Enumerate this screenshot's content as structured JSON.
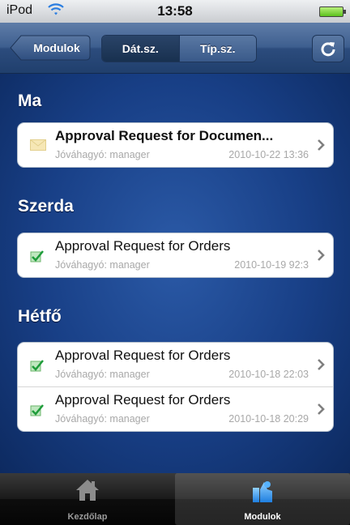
{
  "status": {
    "device": "iPod",
    "time": "13:58"
  },
  "nav": {
    "back_label": "Modulok",
    "segments": [
      {
        "label": "Dát.sz."
      },
      {
        "label": "Típ.sz."
      }
    ],
    "selected_segment": 0,
    "refresh_icon": "refresh-icon"
  },
  "sections": [
    {
      "title": "Ma",
      "items": [
        {
          "title": "Approval Request for Documen...",
          "subtitle": "Jóváhagyó: manager",
          "date": "2010-10-22 13:36",
          "unread": true,
          "icon": "envelope-icon"
        }
      ]
    },
    {
      "title": "Szerda",
      "items": [
        {
          "title": "Approval Request for Orders",
          "subtitle": "Jóváhagyó: manager",
          "date": "2010-10-19 92:3",
          "unread": false,
          "icon": "checkmark-doc-icon"
        }
      ]
    },
    {
      "title": "Hétfő",
      "items": [
        {
          "title": "Approval Request for Orders",
          "subtitle": "Jóváhagyó: manager",
          "date": "2010-10-18 22:03",
          "unread": false,
          "icon": "checkmark-doc-icon"
        },
        {
          "title": "Approval Request for Orders",
          "subtitle": "Jóváhagyó: manager",
          "date": "2010-10-18 20:29",
          "unread": false,
          "icon": "checkmark-doc-icon"
        }
      ]
    }
  ],
  "tabbar": {
    "tabs": [
      {
        "label": "Kezdőlap",
        "icon": "home-icon",
        "active": false
      },
      {
        "label": "Modulok",
        "icon": "modules-icon",
        "active": true
      }
    ]
  },
  "colors": {
    "nav_bar": "#3e5f8f",
    "content_bg": "#183f86",
    "tab_active_label": "#ffffff",
    "tab_inactive_label": "#9a9a9a"
  }
}
